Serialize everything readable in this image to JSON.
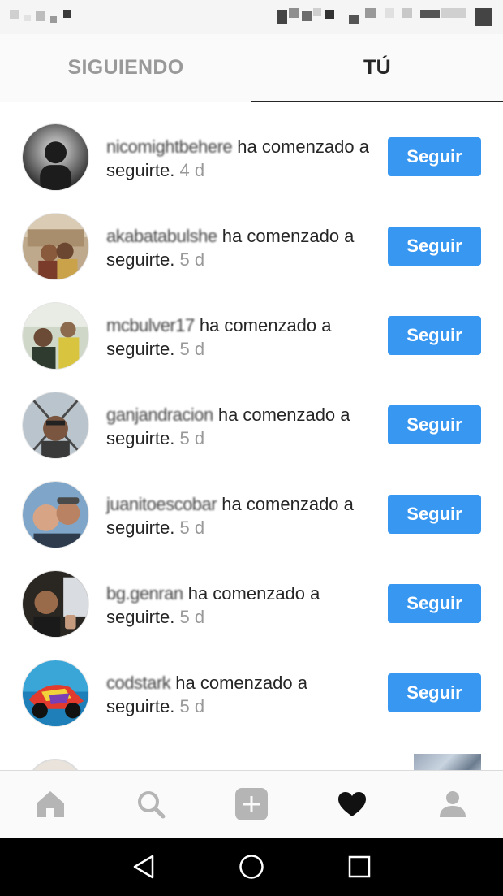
{
  "tabs": {
    "following_label": "SIGUIENDO",
    "you_label": "TÚ"
  },
  "notifications": [
    {
      "username": "nicomightbehere",
      "action": " ha comenzado a seguirte.",
      "time": " 4 d",
      "button_label": "Seguir"
    },
    {
      "username": "akabatabulshe",
      "action": " ha comenzado a seguirte.",
      "time": " 5 d",
      "button_label": "Seguir"
    },
    {
      "username": "mcbulver17",
      "action": " ha comenzado a seguirte.",
      "time": " 5 d",
      "button_label": "Seguir"
    },
    {
      "username": "ganjandracion",
      "action": " ha comenzado a seguirte.",
      "time": " 5 d",
      "button_label": "Seguir"
    },
    {
      "username": "juanitoescobar",
      "action": " ha comenzado a seguirte.",
      "time": " 5 d",
      "button_label": "Seguir"
    },
    {
      "username": "bg.genran",
      "action": " ha comenzado a seguirte.",
      "time": " 5 d",
      "button_label": "Seguir"
    },
    {
      "username": "codstark",
      "action": " ha comenzado a seguirte.",
      "time": " 5 d",
      "button_label": "Seguir"
    }
  ],
  "bottom_nav": {
    "items": [
      "home-icon",
      "search-icon",
      "add-icon",
      "heart-icon",
      "profile-icon"
    ],
    "active": "heart-icon"
  },
  "system_bar": {
    "items": [
      "back-icon",
      "home-circle-icon",
      "recents-icon"
    ]
  },
  "colors": {
    "accent": "#3897f0",
    "text": "#262626",
    "muted": "#999999"
  }
}
